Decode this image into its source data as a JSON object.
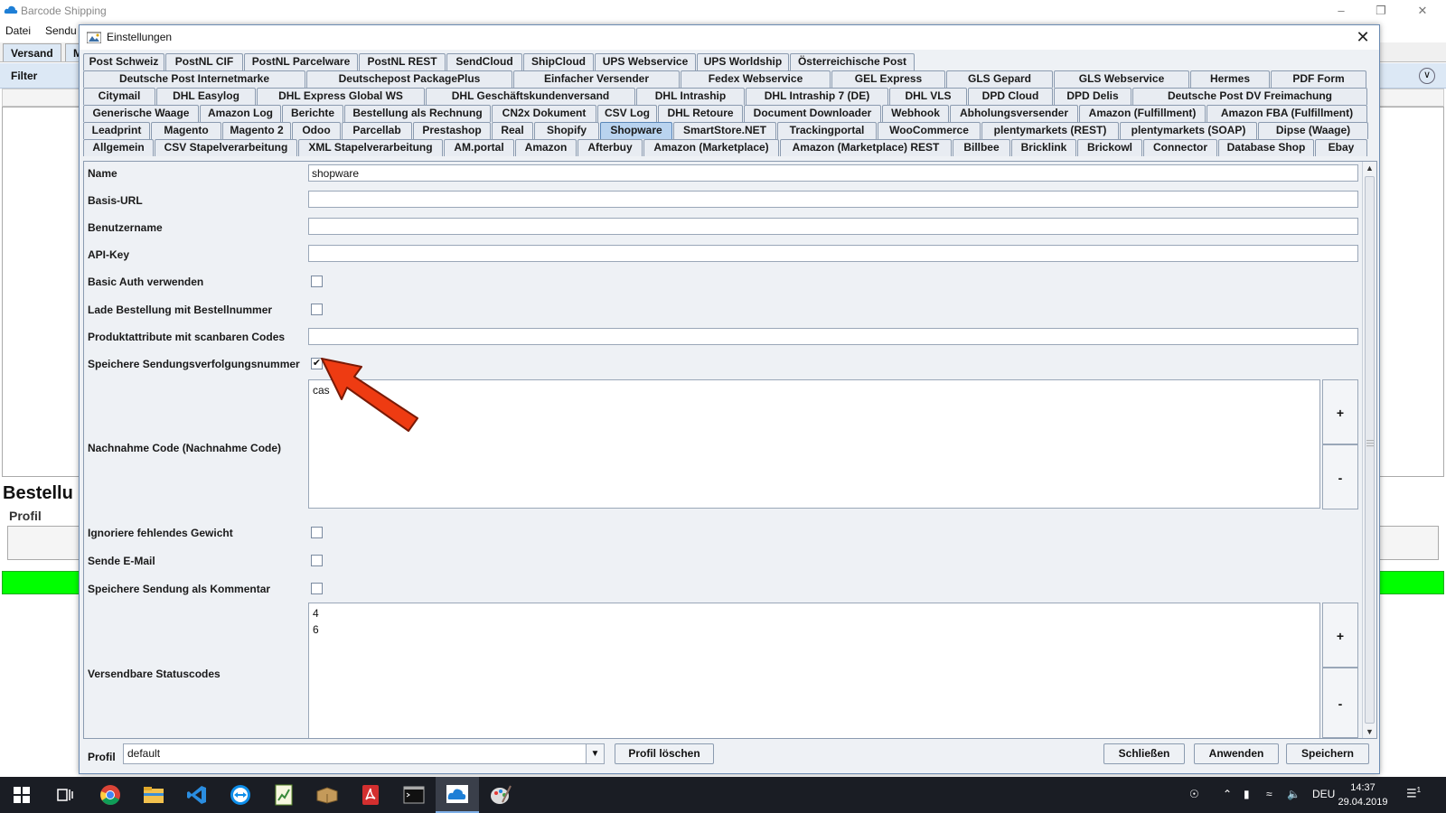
{
  "app": {
    "title": "Barcode Shipping",
    "menu": [
      "Datei",
      "Sendu"
    ],
    "tabs": [
      "Versand",
      "M"
    ],
    "filter_label": "Filter",
    "section_title": "Bestellu",
    "profil_label": "Profil"
  },
  "dialog": {
    "title": "Einstellungen",
    "tab_rows": [
      [
        "Post Schweiz",
        "PostNL CIF",
        "PostNL Parcelware",
        "PostNL REST",
        "SendCloud",
        "ShipCloud",
        "UPS Webservice",
        "UPS Worldship",
        "Österreichische Post"
      ],
      [
        "Deutsche Post Internetmarke",
        "Deutschepost PackagePlus",
        "Einfacher Versender",
        "Fedex Webservice",
        "GEL Express",
        "GLS Gepard",
        "GLS Webservice",
        "Hermes",
        "PDF Form"
      ],
      [
        "Citymail",
        "DHL Easylog",
        "DHL Express Global WS",
        "DHL Geschäftskundenversand",
        "DHL Intraship",
        "DHL Intraship 7 (DE)",
        "DHL VLS",
        "DPD Cloud",
        "DPD Delis",
        "Deutsche Post DV Freimachung"
      ],
      [
        "Generische Waage",
        "Amazon Log",
        "Berichte",
        "Bestellung als Rechnung",
        "CN2x Dokument",
        "CSV Log",
        "DHL Retoure",
        "Document Downloader",
        "Webhook",
        "Abholungsversender",
        "Amazon (Fulfillment)",
        "Amazon FBA (Fulfillment)"
      ],
      [
        "Leadprint",
        "Magento",
        "Magento 2",
        "Odoo",
        "Parcellab",
        "Prestashop",
        "Real",
        "Shopify",
        "Shopware",
        "SmartStore.NET",
        "Trackingportal",
        "WooCommerce",
        "plentymarkets (REST)",
        "plentymarkets (SOAP)",
        "Dipse (Waage)"
      ],
      [
        "Allgemein",
        "CSV Stapelverarbeitung",
        "XML Stapelverarbeitung",
        "AM.portal",
        "Amazon",
        "Afterbuy",
        "Amazon (Marketplace)",
        "Amazon (Marketplace) REST",
        "Billbee",
        "Bricklink",
        "Brickowl",
        "Connector",
        "Database Shop",
        "Ebay"
      ]
    ],
    "selected_tab": "Shopware",
    "fields": {
      "name_label": "Name",
      "name_value": "shopware",
      "baseurl_label": "Basis-URL",
      "baseurl_value": "",
      "user_label": "Benutzername",
      "user_value": "",
      "apikey_label": "API-Key",
      "apikey_value": "",
      "basicauth_label": "Basic Auth verwenden",
      "basicauth_checked": false,
      "lade_label": "Lade Bestellung mit Bestellnummer",
      "lade_checked": false,
      "produkt_label": "Produktattribute mit scanbaren Codes",
      "produkt_value": "",
      "speichere_tracking_label": "Speichere Sendungsverfolgungsnummer",
      "speichere_tracking_checked": true,
      "nachnahme_label": "Nachnahme Code (Nachnahme Code)",
      "nachnahme_items": [
        "cas"
      ],
      "ignoriere_label": "Ignoriere fehlendes Gewicht",
      "ignoriere_checked": false,
      "email_label": "Sende E-Mail",
      "email_checked": false,
      "kommentar_label": "Speichere Sendung als Kommentar",
      "kommentar_checked": false,
      "status_label": "Versendbare Statuscodes",
      "status_items": [
        "4",
        "6"
      ],
      "plus": "+",
      "minus": "-"
    },
    "bottom": {
      "profil_label": "Profil",
      "profil_value": "default",
      "delete_button": "Profil löschen",
      "close_button": "Schließen",
      "apply_button": "Anwenden",
      "save_button": "Speichern"
    }
  },
  "taskbar": {
    "language": "DEU",
    "time": "14:37",
    "date": "29.04.2019",
    "notification_count": "1"
  }
}
